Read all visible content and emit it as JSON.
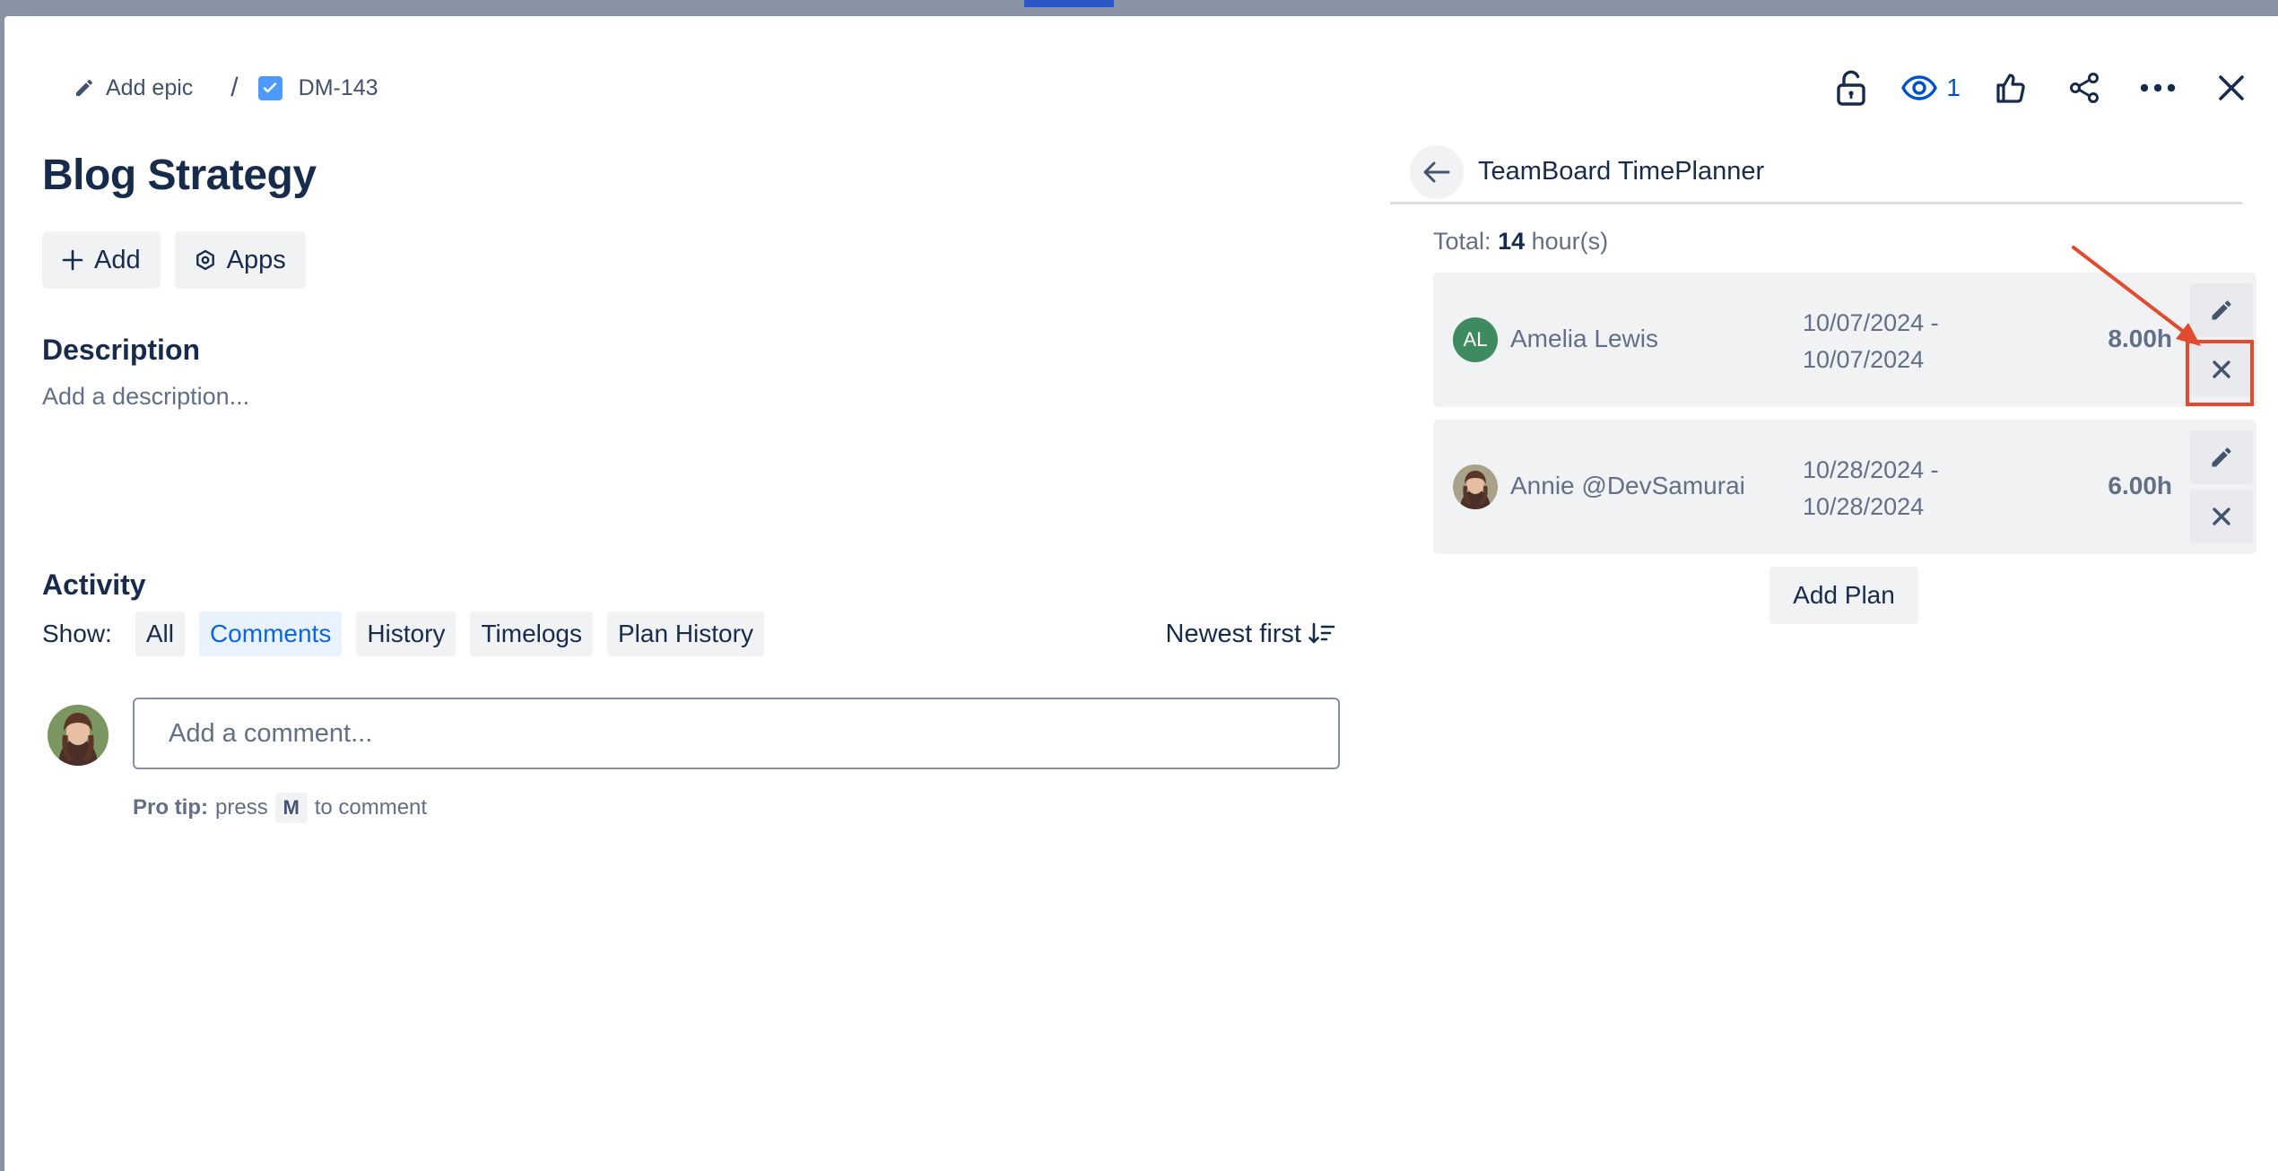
{
  "breadcrumb": {
    "add_epic": "Add epic",
    "separator": "/",
    "issue_key": "DM-143"
  },
  "header_actions": {
    "watch_count": "1",
    "icons": [
      "lock-open-icon",
      "eye-icon",
      "thumbs-up-icon",
      "share-icon",
      "more-icon",
      "close-icon"
    ]
  },
  "issue": {
    "title": "Blog Strategy",
    "add_label": "Add",
    "apps_label": "Apps"
  },
  "description": {
    "heading": "Description",
    "placeholder": "Add a description..."
  },
  "activity": {
    "heading": "Activity",
    "show_label": "Show:",
    "filters": [
      {
        "label": "All",
        "selected": false
      },
      {
        "label": "Comments",
        "selected": true
      },
      {
        "label": "History",
        "selected": false
      },
      {
        "label": "Timelogs",
        "selected": false
      },
      {
        "label": "Plan History",
        "selected": false
      }
    ],
    "sort_label": "Newest first",
    "comment_placeholder": "Add a comment...",
    "protip_bold": "Pro tip:",
    "protip_press": "press",
    "protip_key": "M",
    "protip_tail": "to comment"
  },
  "panel": {
    "title": "TeamBoard TimePlanner",
    "total_prefix": "Total:",
    "total_value": "14",
    "total_suffix": "hour(s)",
    "plans": [
      {
        "initials": "AL",
        "name": "Amelia Lewis",
        "date_start": "10/07/2024 -",
        "date_end": "10/07/2024",
        "hours": "8.00h"
      },
      {
        "initials": "",
        "name": "Annie @DevSamurai",
        "date_start": "10/28/2024 -",
        "date_end": "10/28/2024",
        "hours": "6.00h"
      }
    ],
    "add_plan_label": "Add Plan"
  },
  "colors": {
    "accent": "#0c66e4",
    "annotation": "#e34b2f",
    "avatar_green": "#3d8b5e"
  }
}
